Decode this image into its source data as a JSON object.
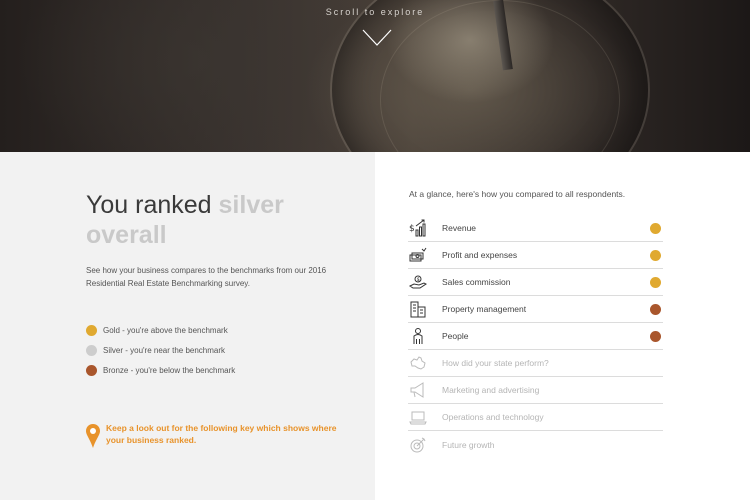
{
  "hero": {
    "scroll_label": "Scroll to explore"
  },
  "colors": {
    "gold": "#e0a930",
    "silver": "#cdcdcd",
    "bronze": "#a9562c",
    "accent_orange": "#e8932b"
  },
  "summary": {
    "heading_plain": "You ranked",
    "heading_accent": "silver overall",
    "intro": "See how your business compares to the benchmarks from our 2016 Residential Real Estate Benchmarking survey.",
    "legend": [
      {
        "label": "Gold - you're above the benchmark",
        "color": "#e0a930"
      },
      {
        "label": "Silver - you're near the benchmark",
        "color": "#cdcdcd"
      },
      {
        "label": "Bronze - you're below the benchmark",
        "color": "#a9562c"
      }
    ],
    "key_callout": "Keep a look out for the following key which shows where your business ranked."
  },
  "glance": {
    "intro": "At a glance, here's how you compared to all respondents.",
    "items": [
      {
        "label": "Revenue",
        "icon": "revenue-chart-icon",
        "rank": "gold"
      },
      {
        "label": "Profit and expenses",
        "icon": "money-stack-icon",
        "rank": "gold"
      },
      {
        "label": "Sales commission",
        "icon": "hand-coins-icon",
        "rank": "gold"
      },
      {
        "label": "Property management",
        "icon": "buildings-icon",
        "rank": "bronze"
      },
      {
        "label": "People",
        "icon": "person-icon",
        "rank": "bronze"
      },
      {
        "label": "How did your state perform?",
        "icon": "australia-map-icon",
        "rank": ""
      },
      {
        "label": "Marketing and advertising",
        "icon": "megaphone-icon",
        "rank": ""
      },
      {
        "label": "Operations and technology",
        "icon": "laptop-icon",
        "rank": ""
      },
      {
        "label": "Future growth",
        "icon": "target-icon",
        "rank": ""
      }
    ]
  }
}
